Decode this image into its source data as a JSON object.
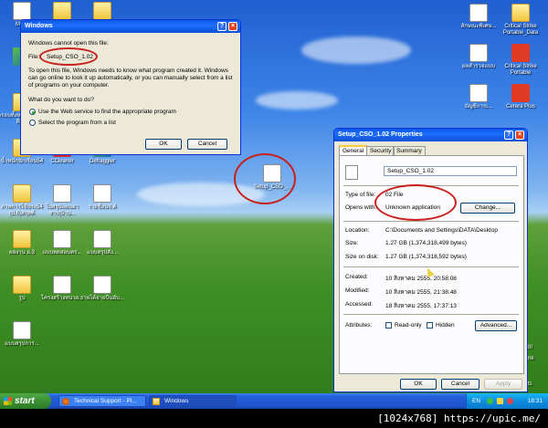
{
  "desktop": {
    "left_icons": [
      {
        "label": "My C",
        "icon": "my-computer-icon",
        "kind": "doc"
      },
      {
        "label": "",
        "icon": "folder-icon",
        "kind": "folder"
      },
      {
        "label": "",
        "icon": "folder-icon",
        "kind": "folder"
      },
      {
        "label": "",
        "icon": "program-icon",
        "kind": "defrag"
      },
      {
        "label": "Power DVD 10",
        "icon": "powerdvd-icon",
        "kind": "dvd"
      },
      {
        "label": "VLC media player",
        "icon": "vlc-icon",
        "kind": "vlc"
      },
      {
        "label": "ครอบทั้งหมดประเมินสีเล็ก",
        "icon": "folder-icon",
        "kind": "folder"
      },
      {
        "label": "Adobe Reader X",
        "icon": "adobe-reader-icon",
        "kind": "pdf"
      },
      {
        "label": "Photo Scape",
        "icon": "photoscape-icon",
        "kind": "camera"
      },
      {
        "label": "น้ำหนักนักเรียน54",
        "icon": "folder-icon",
        "kind": "folder"
      },
      {
        "label": "CCleaner",
        "icon": "ccleaner-icon",
        "kind": "ccleaner"
      },
      {
        "label": "Defraggler",
        "icon": "defraggler-icon",
        "kind": "defrag"
      },
      {
        "label": "ภาพการใช้ประ54 (ป.6)สกุลค์",
        "icon": "folder-icon",
        "kind": "folder"
      },
      {
        "label": "ใบสรุปแผนอาชาร(บ้าน...",
        "icon": "word-document-icon",
        "kind": "doc"
      },
      {
        "label": "รายชื่อนร.ค์",
        "icon": "excel-document-icon",
        "kind": "doc"
      },
      {
        "label": "ผลงาน อ.3",
        "icon": "folder-icon",
        "kind": "folder"
      },
      {
        "label": "แบบทดสอบคร...",
        "icon": "word-document-icon",
        "kind": "doc"
      },
      {
        "label": "แบบสรุปสัง...",
        "icon": "excel-document-icon",
        "kind": "doc"
      },
      {
        "label": "รูป",
        "icon": "folder-icon",
        "kind": "folder"
      },
      {
        "label": "โครงสร้างหน่วย...",
        "icon": "word-document-icon",
        "kind": "doc"
      },
      {
        "label": "รายได้จ่ายปีนอับ...",
        "icon": "excel-document-icon",
        "kind": "doc"
      },
      {
        "label": "แบบสรุปการ...",
        "icon": "word-document-icon",
        "kind": "doc"
      }
    ],
    "right_icons": [
      {
        "label": "ลักษณะพิเศษ...",
        "icon": "word-document-icon",
        "kind": "doc"
      },
      {
        "label": "Critical Strike Portable_Data",
        "icon": "folder-icon",
        "kind": "folder"
      },
      {
        "label": "ผลสำรวจแบบ",
        "icon": "word-document-icon",
        "kind": "doc"
      },
      {
        "label": "Critical Strike Portable",
        "icon": "critical-strike-icon",
        "kind": "cs"
      },
      {
        "label": "บัญชีการเ...",
        "icon": "word-document-icon",
        "kind": "doc"
      },
      {
        "label": "Cerera Plus",
        "icon": "cerera-plus-icon",
        "kind": "cs"
      }
    ],
    "setup_icon_label": "Setup_CSO_...",
    "partial_right_labels": [
      "ork",
      "III",
      "ne",
      "ts"
    ]
  },
  "open_dialog": {
    "title": "Windows",
    "heading": "Windows cannot open this file:",
    "file_label": "File:",
    "file_name": "Setup_CSO_1.02",
    "description": "To open this file, Windows needs to know what program created it.  Windows can go online to look it up automatically, or you can manually select from a list of programs on your computer.",
    "question": "What do you want to do?",
    "option_web": "Use the Web service to find the appropriate program",
    "option_list": "Select the program from a list",
    "ok_label": "OK",
    "cancel_label": "Cancel"
  },
  "properties_dialog": {
    "title": "Setup_CSO_1.02 Properties",
    "tabs": [
      "General",
      "Security",
      "Summary"
    ],
    "file_name": "Setup_CSO_1.02",
    "type_label": "Type of file:",
    "type_value": "02 File",
    "opens_label": "Opens with:",
    "opens_value": "Unknown application",
    "change_label": "Change...",
    "location_label": "Location:",
    "location_value": "C:\\Documents and Settings\\DATA\\Desktop",
    "size_label": "Size:",
    "size_value": "1.27 GB (1,374,318,499 bytes)",
    "size_on_disk_label": "Size on disk:",
    "size_on_disk_value": "1.27 GB (1,374,318,592 bytes)",
    "created_label": "Created:",
    "created_value": "10 สิงหาคม 2555, 20:58:08",
    "modified_label": "Modified:",
    "modified_value": "10 สิงหาคม 2555, 21:38:48",
    "accessed_label": "Accessed:",
    "accessed_value": "18 สิงหาคม 2555, 17:37:13",
    "attributes_label": "Attributes:",
    "readonly_label": "Read-only",
    "hidden_label": "Hidden",
    "advanced_label": "Advanced...",
    "ok_label": "OK",
    "cancel_label": "Cancel",
    "apply_label": "Apply"
  },
  "taskbar": {
    "start_label": "start",
    "tasks": [
      {
        "label": "Technical Support - Pl...",
        "icon": "firefox-icon"
      },
      {
        "label": "Windows",
        "icon": "folder-window-icon"
      }
    ],
    "language": "EN",
    "clock": "18:31"
  },
  "caption": "[1024x768] https://upic.me/"
}
